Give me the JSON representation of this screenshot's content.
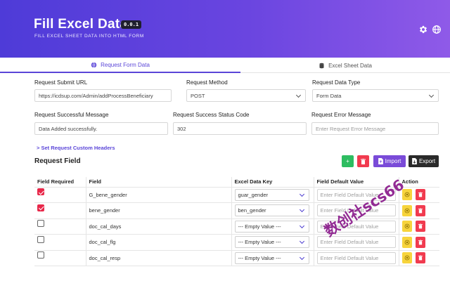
{
  "header": {
    "title": "Fill Excel Data",
    "version": "0.0.1",
    "subtitle": "FILL EXCEL SHEET DATA INTO HTML FORM"
  },
  "tabs": [
    {
      "label": "Request Form Data",
      "icon": "globe-icon",
      "active": true
    },
    {
      "label": "Excel Sheet Data",
      "icon": "database-icon",
      "active": false
    }
  ],
  "form": {
    "url_label": "Request Submit URL",
    "url_value": "https://icdsup.com/Admin/addProcessBeneficiary",
    "method_label": "Request Method",
    "method_value": "POST",
    "data_type_label": "Request Data Type",
    "data_type_value": "Form Data",
    "success_msg_label": "Request Successful Message",
    "success_msg_value": "Data Added successfully.",
    "status_code_label": "Request Success Status Code",
    "status_code_value": "302",
    "error_msg_label": "Request Error Message",
    "error_msg_placeholder": "Enter Request Error Message",
    "custom_headers_link": "> Set Request Custom Headers"
  },
  "request_field": {
    "title": "Request Field",
    "import_label": "Import",
    "export_label": "Export",
    "columns": [
      "Field Required",
      "Field",
      "Excel Data Key",
      "Field Default Value",
      "Action"
    ],
    "default_placeholder": "Enter Field Default Value",
    "rows": [
      {
        "required": true,
        "field": "G_bene_gender",
        "key": "guar_gender"
      },
      {
        "required": true,
        "field": "bene_gender",
        "key": "ben_gender"
      },
      {
        "required": false,
        "field": "doc_cal_days",
        "key": "--- Empty Value ---"
      },
      {
        "required": false,
        "field": "doc_cal_flg",
        "key": "--- Empty Value ---"
      },
      {
        "required": false,
        "field": "doc_cal_resp",
        "key": "--- Empty Value ---"
      }
    ]
  },
  "watermark": "数创社scs66",
  "colors": {
    "accent": "#5a45d8",
    "add": "#2ebd61",
    "delete": "#f13b4f",
    "import": "#7a4bd8",
    "export": "#2a2a2a",
    "view": "#f7d43c"
  }
}
